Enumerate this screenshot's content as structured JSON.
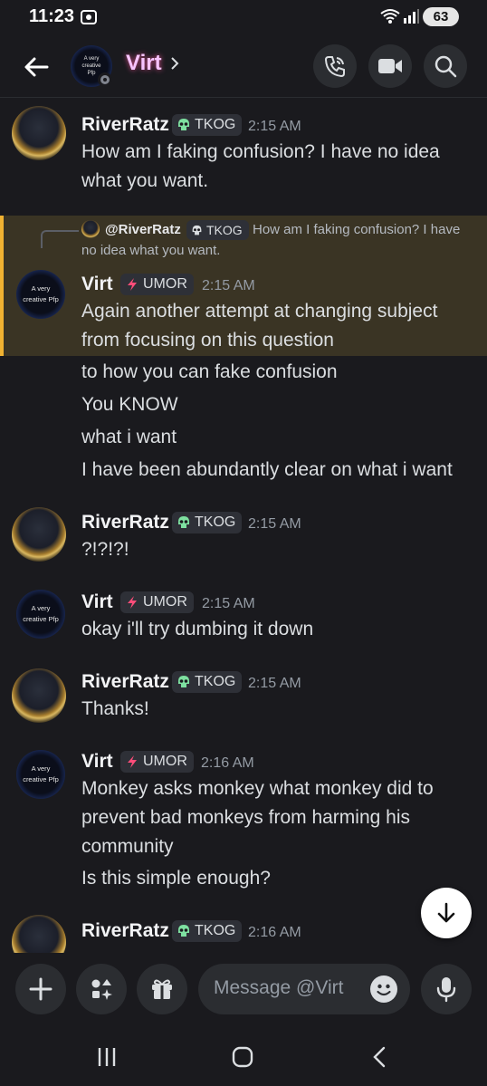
{
  "status": {
    "time": "11:23",
    "battery": "63"
  },
  "header": {
    "channel_name": "Virt",
    "avatar_text": "A very creative Pfp"
  },
  "tags": {
    "tkog": "TKOG",
    "umor": "UMOR"
  },
  "users": {
    "riverratz": "RiverRatz",
    "virt": "Virt"
  },
  "messages": [
    {
      "author": "RiverRatz",
      "time": "2:15 AM",
      "lines": [
        "How am I faking confusion? I have no idea",
        "what you want."
      ]
    },
    {
      "author": "Virt",
      "time": "2:15 AM",
      "reply": {
        "author": "@RiverRatz",
        "text1": "How am I faking confusion? I have",
        "text2": "no idea what you want."
      },
      "lines": [
        "Again another attempt at changing subject",
        "from focusing on this question",
        "to how you can fake confusion",
        "You KNOW",
        "what i want",
        "I have been abundantly clear on what i want"
      ]
    },
    {
      "author": "RiverRatz",
      "time": "2:15 AM",
      "lines": [
        "?!?!?!"
      ]
    },
    {
      "author": "Virt",
      "time": "2:15 AM",
      "lines": [
        "okay i'll try dumbing it down"
      ]
    },
    {
      "author": "RiverRatz",
      "time": "2:15 AM",
      "lines": [
        "Thanks!"
      ]
    },
    {
      "author": "Virt",
      "time": "2:16 AM",
      "lines": [
        "Monkey asks monkey what monkey did to",
        "prevent bad monkeys from harming his",
        "community",
        "Is this simple enough?"
      ]
    },
    {
      "author": "RiverRatz",
      "time": "2:16 AM",
      "lines": []
    }
  ],
  "composer": {
    "placeholder": "Message @Virt"
  },
  "colors": {
    "accent_reply": "#f0b232",
    "name_header": "#f7c4ff",
    "tag_green": "#3ba55d"
  }
}
